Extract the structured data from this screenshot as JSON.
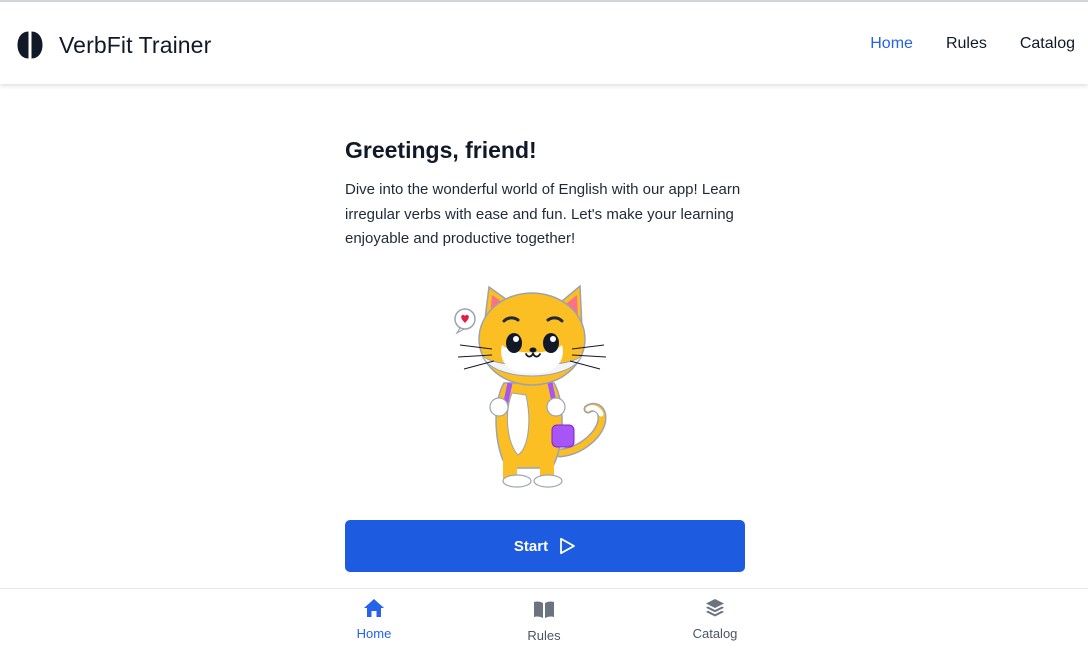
{
  "header": {
    "brand_icon": "brain-icon",
    "title": "VerbFit Trainer",
    "nav": [
      {
        "label": "Home",
        "active": true
      },
      {
        "label": "Rules",
        "active": false
      },
      {
        "label": "Catalog",
        "active": false
      }
    ]
  },
  "main": {
    "heading": "Greetings, friend!",
    "intro": "Dive into the wonderful world of English with our app! Learn irregular verbs with ease and fun. Let's make your learning enjoyable and productive together!",
    "illustration": "cat-mascot-with-backpack",
    "start_label": "Start",
    "start_icon": "play-icon"
  },
  "bottom_nav": [
    {
      "label": "Home",
      "icon": "house-icon",
      "active": true
    },
    {
      "label": "Rules",
      "icon": "book-icon",
      "active": false
    },
    {
      "label": "Catalog",
      "icon": "layers-icon",
      "active": false
    }
  ],
  "colors": {
    "accent": "#2563eb",
    "button": "#1d5be0",
    "text": "#111827",
    "muted": "#4b5563"
  }
}
